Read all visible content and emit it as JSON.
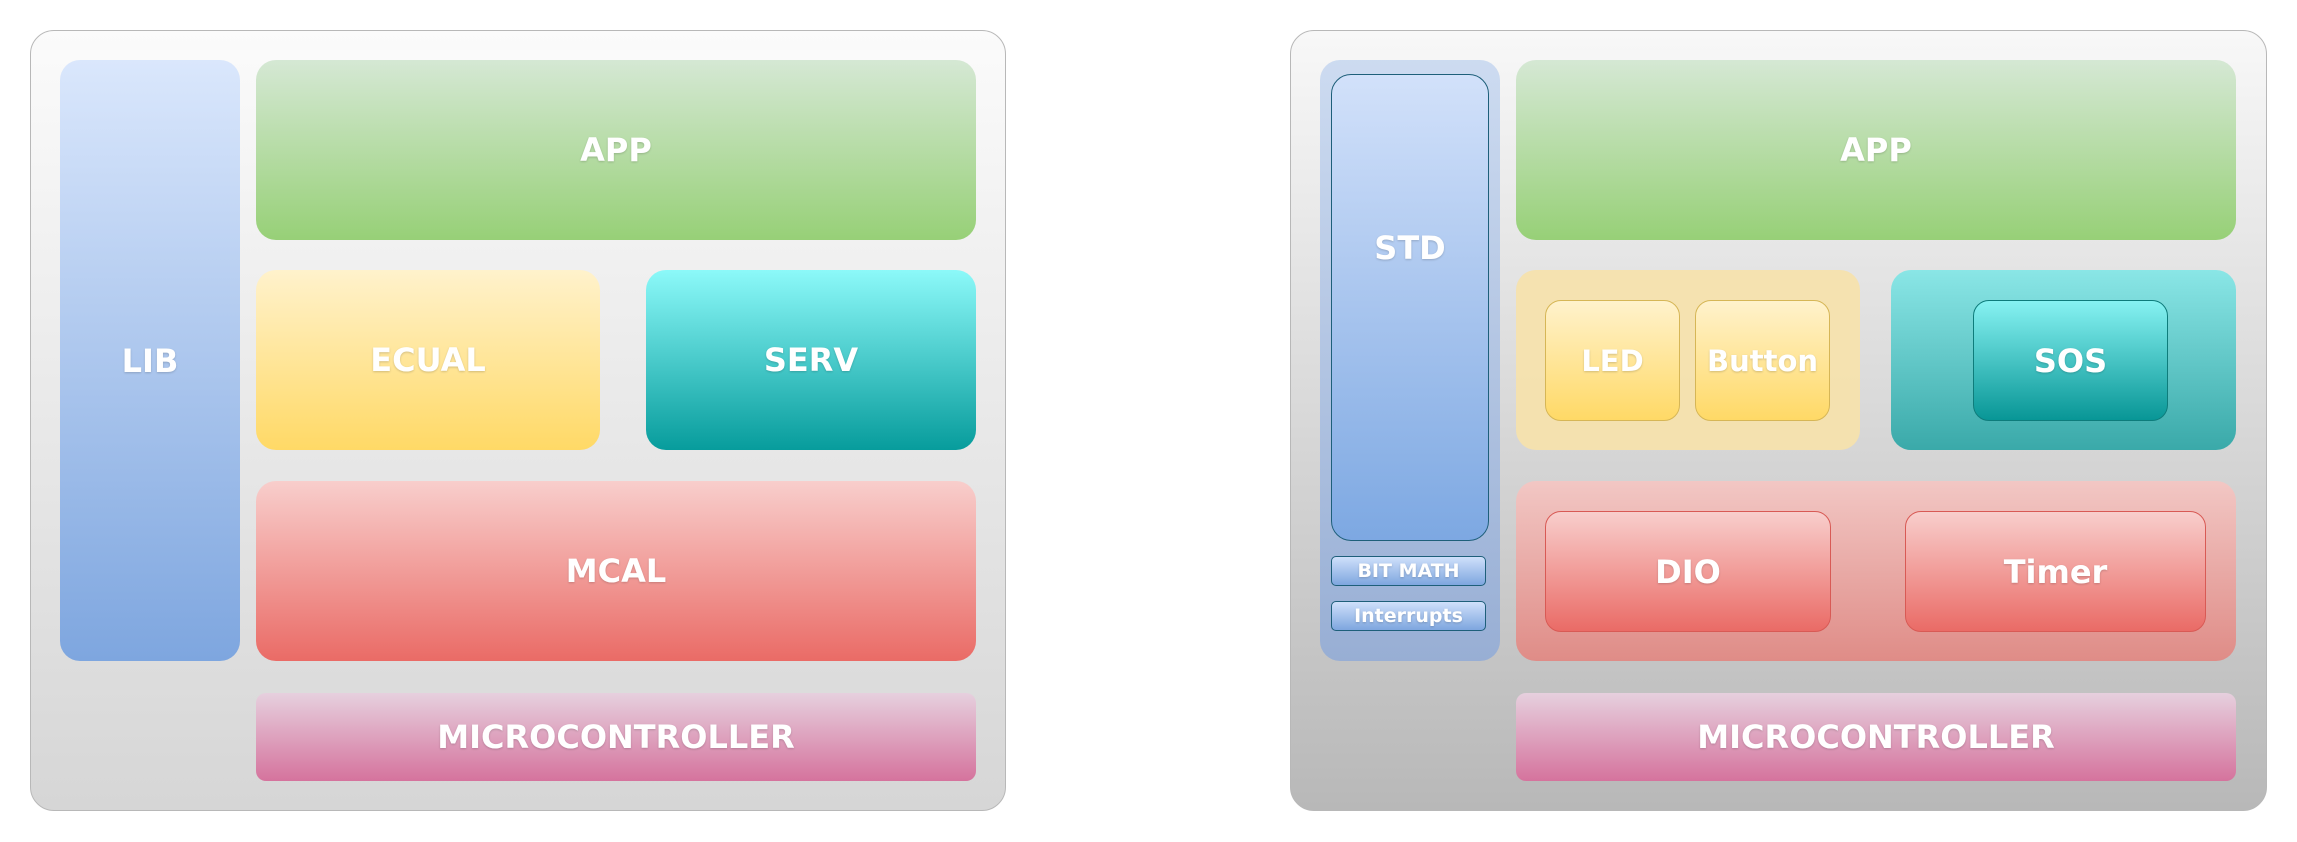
{
  "left": {
    "lib": "LIB",
    "app": "APP",
    "ecual": "ECUAL",
    "serv": "SERV",
    "mcal": "MCAL",
    "microcontroller": "MICROCONTROLLER"
  },
  "right": {
    "std": "STD",
    "bit_math": "BIT MATH",
    "interrupts": "Interrupts",
    "app": "APP",
    "led": "LED",
    "button": "Button",
    "sos": "SOS",
    "dio": "DIO",
    "timer": "Timer",
    "microcontroller": "MICROCONTROLLER"
  }
}
